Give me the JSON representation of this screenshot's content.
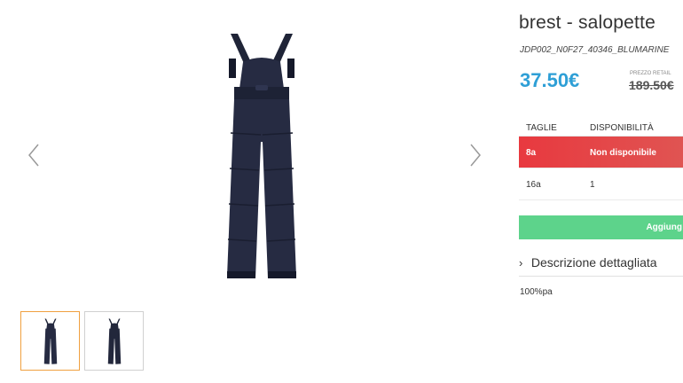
{
  "product": {
    "title": "brest - salopette",
    "sku": "JDP002_N0F27_40346_BLUMARINE",
    "price": "37.50€",
    "retail_label": "PREZZO RETAIL",
    "retail_price": "189.50€"
  },
  "sizes": {
    "header_size": "TAGLIE",
    "header_availability": "DISPONIBILITÀ",
    "rows": [
      {
        "size": "8a",
        "availability": "Non disponibile",
        "unavailable": true
      },
      {
        "size": "16a",
        "availability": "1",
        "unavailable": false
      }
    ]
  },
  "add_button": {
    "label": "Aggiung"
  },
  "description": {
    "chevron": "›",
    "header": "Descrizione dettagliata",
    "text": "100%pa"
  },
  "colors": {
    "price_blue": "#2e9fd6",
    "unavailable_red": "#e8393f",
    "add_green": "#5dd38b",
    "thumb_active": "#f0a040",
    "garment_navy": "#23283d"
  },
  "icons": {
    "prev": "chevron-left",
    "next": "chevron-right"
  }
}
